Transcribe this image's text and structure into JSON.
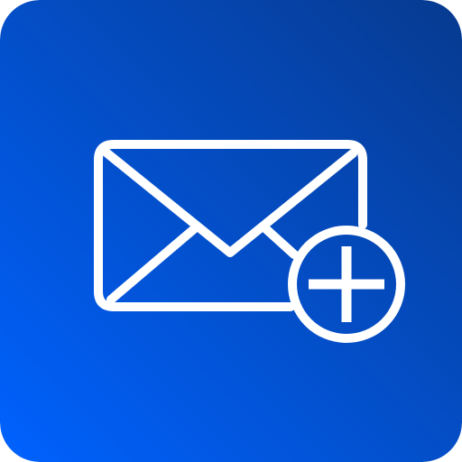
{
  "icon": {
    "name": "add-mail-icon",
    "parts": [
      "envelope-icon",
      "plus-badge-icon"
    ]
  },
  "colors": {
    "gradient_start": "#0062ff",
    "gradient_end": "#073a8f",
    "glyph": "#ffffff"
  }
}
